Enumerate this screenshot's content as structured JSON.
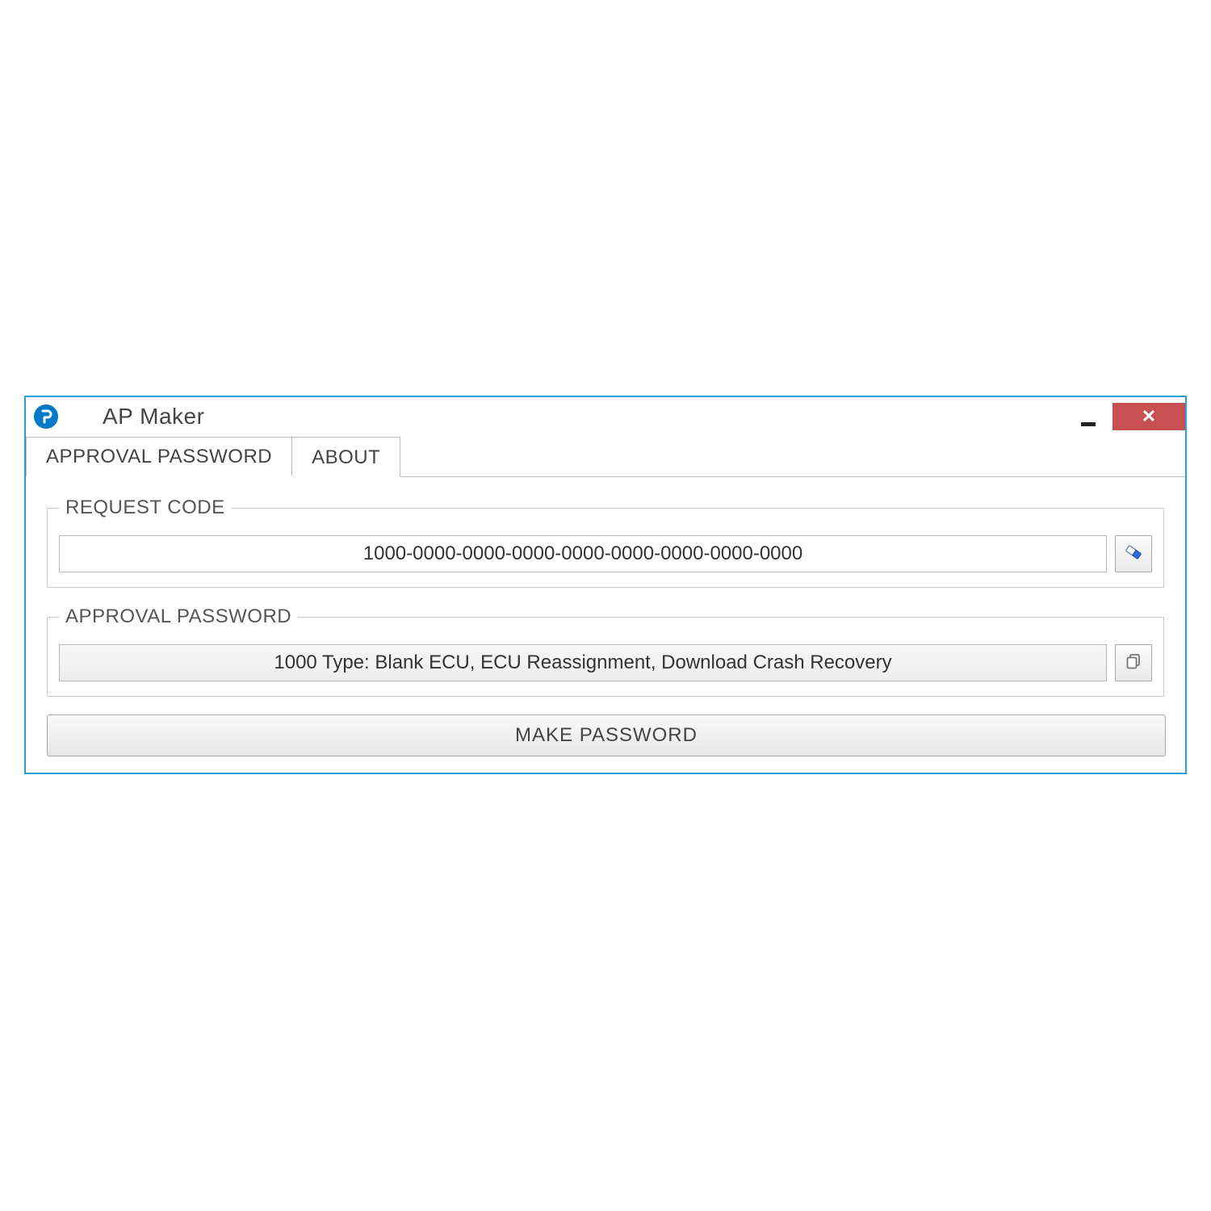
{
  "window": {
    "title": "AP Maker"
  },
  "tabs": [
    {
      "label": "APPROVAL PASSWORD",
      "active": true
    },
    {
      "label": "ABOUT",
      "active": false
    }
  ],
  "request_code": {
    "legend": "REQUEST CODE",
    "value": "1000-0000-0000-0000-0000-0000-0000-0000-0000"
  },
  "approval_password": {
    "legend": "APPROVAL PASSWORD",
    "value": "1000 Type: Blank ECU, ECU Reassignment, Download Crash Recovery"
  },
  "buttons": {
    "make_password": "MAKE PASSWORD"
  },
  "icons": {
    "app": "app-logo",
    "clear": "eraser-icon",
    "copy": "copy-icon"
  }
}
